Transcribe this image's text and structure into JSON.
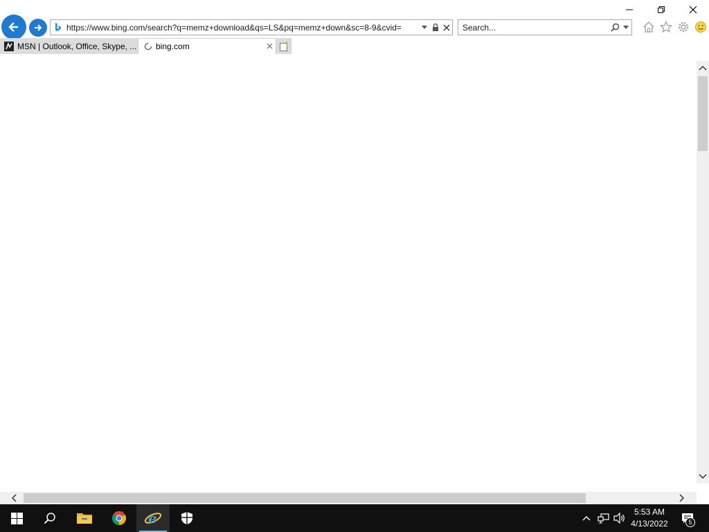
{
  "browser": {
    "address_url": "https://www.bing.com/search?q=memz+download&qs=LS&pq=memz+down&sc=8-9&cvid=",
    "search_placeholder": "Search...",
    "tabs": [
      {
        "label": "MSN | Outlook, Office, Skype, ...",
        "state": "inactive",
        "icon": "msn-icon"
      },
      {
        "label": "bing.com",
        "state": "active",
        "icon": "loading-spinner-icon"
      }
    ],
    "accent_color": "#1f7ad1"
  },
  "taskbar": {
    "apps": [
      {
        "name": "start",
        "icon": "windows-start-icon"
      },
      {
        "name": "search",
        "icon": "search-icon"
      },
      {
        "name": "file-explorer",
        "icon": "folder-icon"
      },
      {
        "name": "chrome",
        "icon": "chrome-icon"
      },
      {
        "name": "internet-explorer",
        "icon": "ie-icon",
        "active": true
      },
      {
        "name": "security",
        "icon": "shield-icon"
      }
    ],
    "time": "5:53 AM",
    "date": "4/13/2022",
    "notification_count": "5"
  }
}
